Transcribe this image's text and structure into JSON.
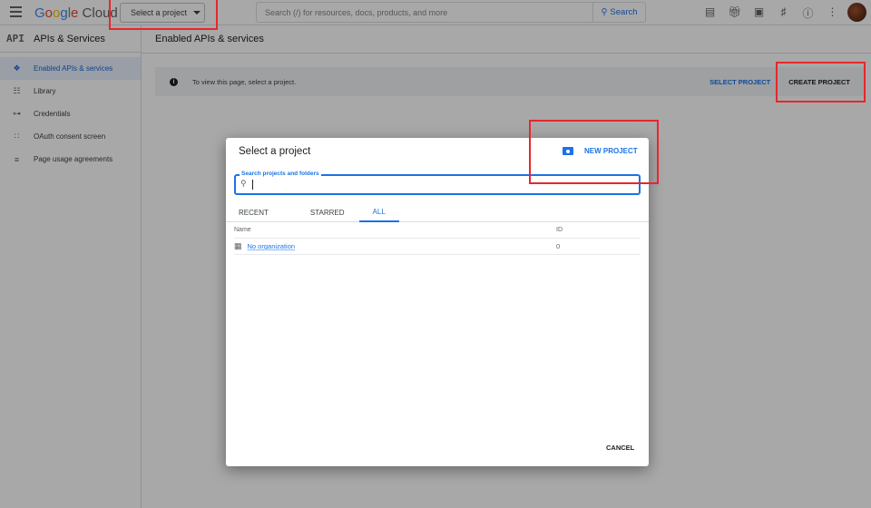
{
  "topbar": {
    "logo": "Google Cloud",
    "project_selector": "Select a project",
    "search_placeholder": "Search (/) for resources, docs, products, and more",
    "search_button": "Search",
    "icons": [
      "gemini-chat-icon",
      "gift-icon",
      "cloud-shell-icon",
      "bell-icon",
      "help-icon",
      "more-vert-icon"
    ]
  },
  "sidebar": {
    "logo": "API",
    "title": "APIs & Services",
    "items": [
      {
        "label": "Enabled APIs & services",
        "icon": "api-diamond-icon",
        "active": true
      },
      {
        "label": "Library",
        "icon": "library-grid-icon"
      },
      {
        "label": "Credentials",
        "icon": "key-icon"
      },
      {
        "label": "OAuth consent screen",
        "icon": "oauth-icon"
      },
      {
        "label": "Page usage agreements",
        "icon": "settings-list-icon"
      }
    ]
  },
  "main": {
    "title": "Enabled APIs & services",
    "banner": {
      "message": "To view this page, select a project.",
      "select_project": "SELECT PROJECT",
      "create_project": "CREATE PROJECT"
    }
  },
  "dialog": {
    "title": "Select a project",
    "new_project": "NEW PROJECT",
    "search_label": "Search projects and folders",
    "search_value": "",
    "tabs": [
      "RECENT",
      "STARRED",
      "ALL"
    ],
    "active_tab": "ALL",
    "columns": [
      "Name",
      "ID"
    ],
    "rows": [
      {
        "name": "No organization",
        "id": "0"
      }
    ],
    "cancel": "CANCEL"
  },
  "colors": {
    "accent": "#1a73e8",
    "annotation": "#e8262d"
  }
}
